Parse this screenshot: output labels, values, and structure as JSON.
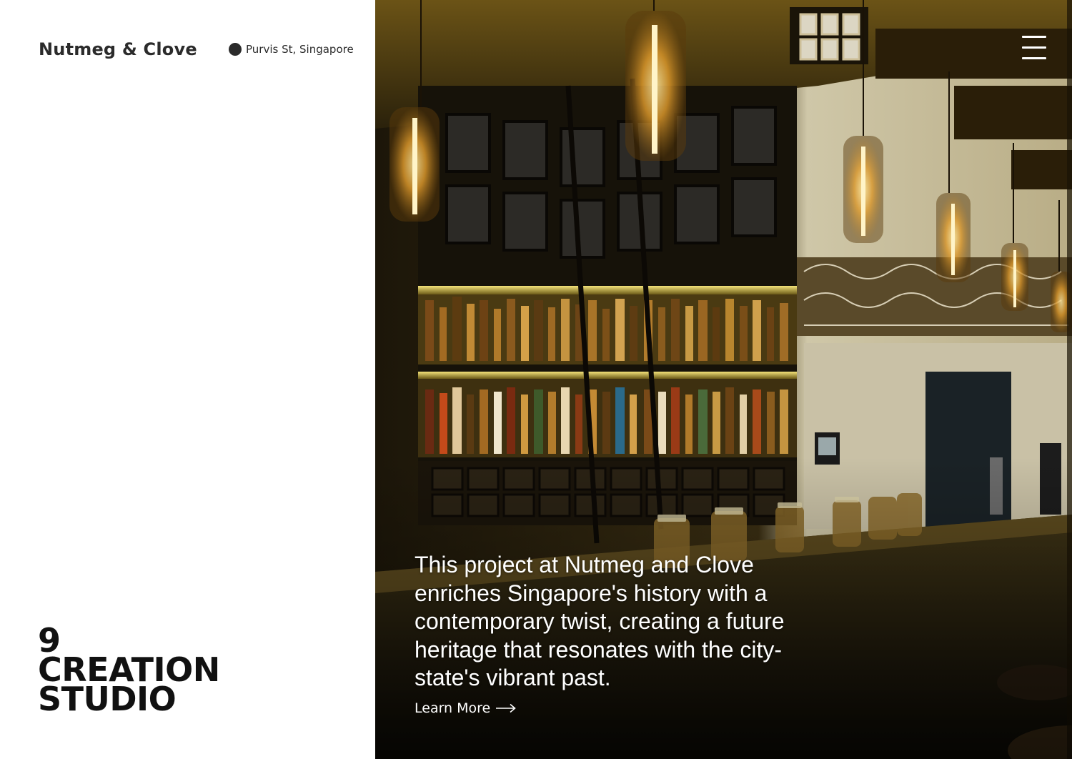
{
  "brand": {
    "name": "Nutmeg & Clove"
  },
  "location": {
    "icon": "location-dot-icon",
    "text": "Purvis St, Singapore"
  },
  "studio": {
    "line1": "9",
    "line2": "CREATION",
    "line3": "STUDIO"
  },
  "hero": {
    "image": "bar-interior-photo",
    "menu_icon": "hamburger-menu-icon",
    "caption": "This project at Nutmeg and Clove enriches Singapore's history with a contemporary twist, creating a future heritage that resonates with the city-state's vibrant past.",
    "link_label": "Learn More",
    "link_icon": "arrow-right-icon"
  },
  "colors": {
    "text_dark": "#2b2b2b",
    "heading": "#111111",
    "overlay_text": "#ffffff"
  }
}
